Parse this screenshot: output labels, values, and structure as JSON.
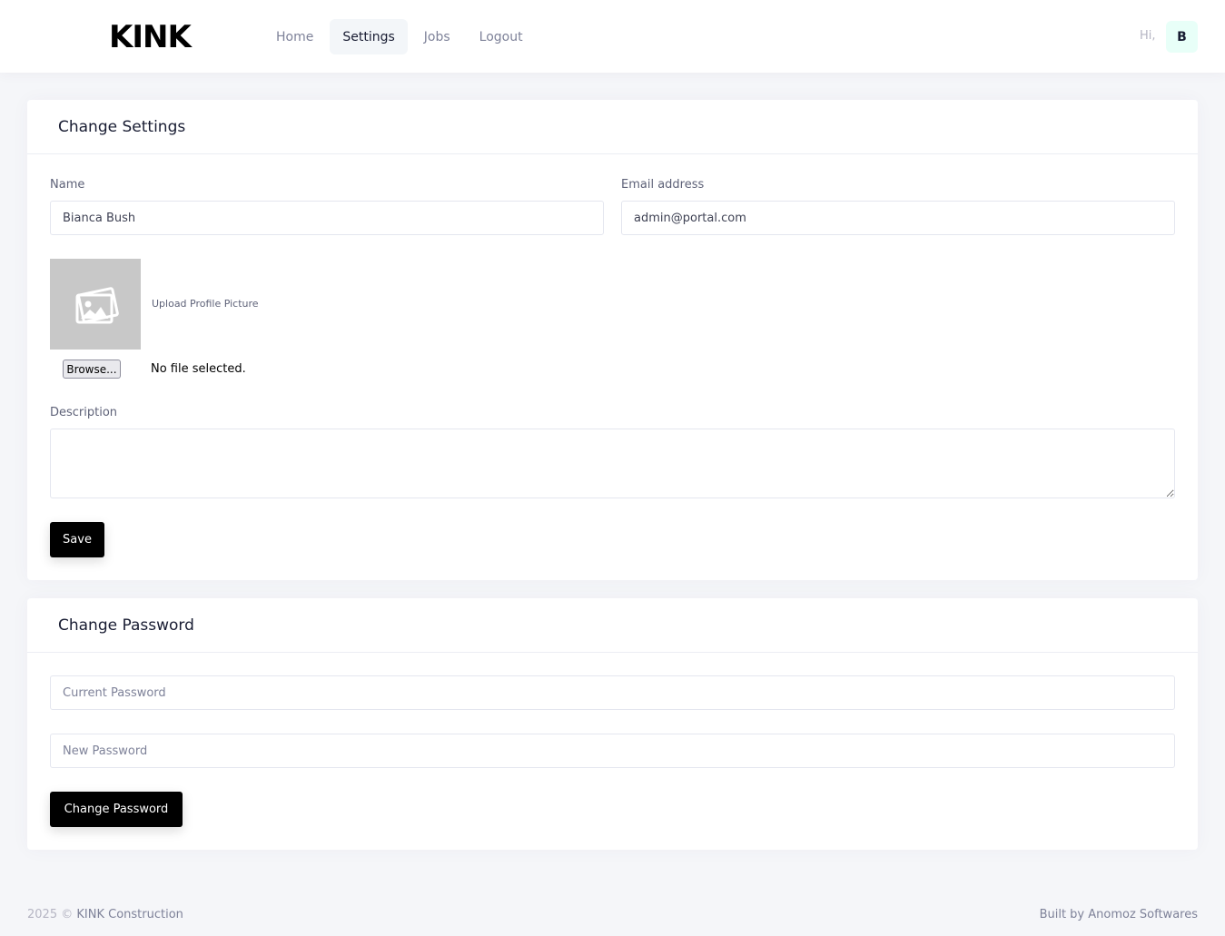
{
  "header": {
    "logo_text": "KINK",
    "nav": [
      {
        "label": "Home",
        "active": false
      },
      {
        "label": "Settings",
        "active": true
      },
      {
        "label": "Jobs",
        "active": false
      },
      {
        "label": "Logout",
        "active": false
      }
    ],
    "greeting": "Hi,",
    "avatar_initial": "B"
  },
  "settings_card": {
    "title": "Change Settings",
    "name_label": "Name",
    "name_value": "Bianca Bush",
    "email_label": "Email address",
    "email_value": "admin@portal.com",
    "upload_label": "Upload Profile Picture",
    "browse_label": "Browse...",
    "file_status": "No file selected.",
    "description_label": "Description",
    "description_value": "",
    "save_label": "Save"
  },
  "password_card": {
    "title": "Change Password",
    "current_placeholder": "Current Password",
    "new_placeholder": "New Password",
    "submit_label": "Change Password"
  },
  "footer": {
    "year": "2025",
    "copyright": "©",
    "company": "KINK Construction",
    "credit": "Built by Anomoz Softwares"
  }
}
